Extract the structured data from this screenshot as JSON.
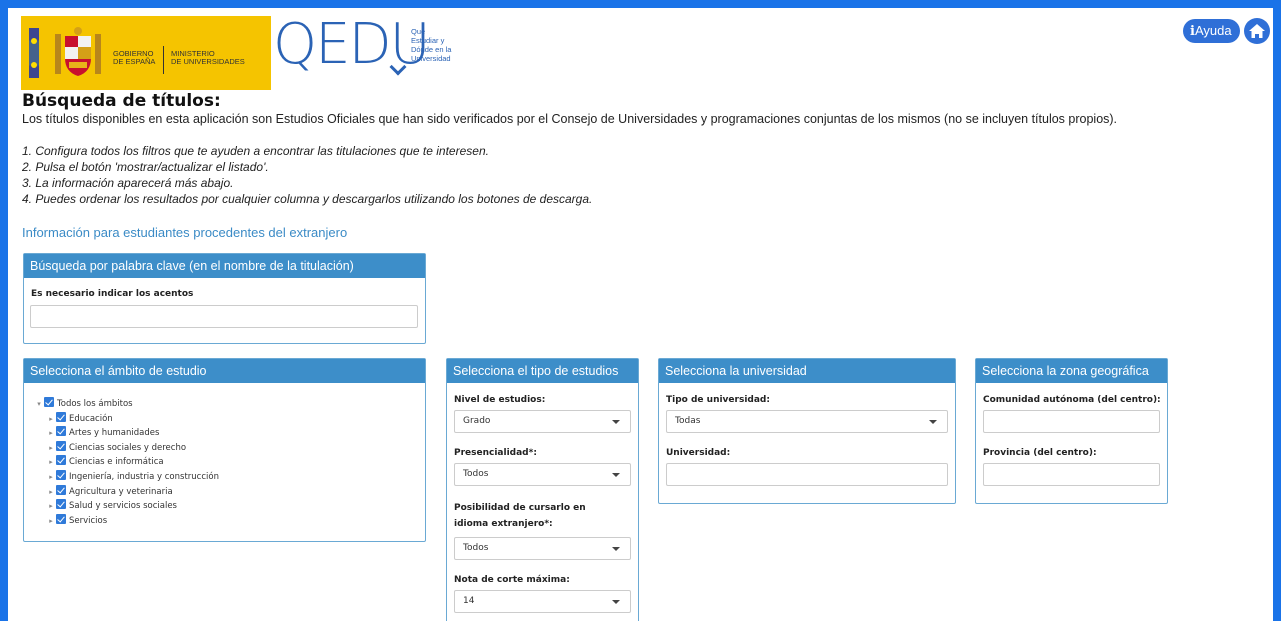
{
  "header": {
    "gov_line1": "GOBIERNO",
    "gov_line2": "DE ESPAÑA",
    "ministry_line1": "MINISTERIO",
    "ministry_line2": "DE UNIVERSIDADES",
    "logo_text": "QEDU",
    "logo_sub": [
      "Qué",
      "Estudiar y",
      "Dónde en la",
      "Universidad"
    ],
    "help_label": "Ayuda",
    "help_icon": "info-icon",
    "home_icon": "home-icon"
  },
  "intro": {
    "title": "Búsqueda de títulos:",
    "description": "Los títulos disponibles en esta aplicación son Estudios Oficiales que han sido verificados por el Consejo de Universidades y programaciones conjuntas de los mismos (no se incluyen títulos propios).",
    "steps": [
      "1. Configura todos los filtros que te ayuden a encontrar las titulaciones que te interesen.",
      "2. Pulsa el botón 'mostrar/actualizar el listado'.",
      "3. La información aparecerá más abajo.",
      "4. Puedes ordenar los resultados por cualquier columna y descargarlos utilizando los botones de descarga."
    ],
    "foreign_link": "Información para estudiantes procedentes del extranjero"
  },
  "keyword_panel": {
    "title": "Búsqueda por palabra clave (en el nombre de la titulación)",
    "label": "Es necesario indicar los acentos",
    "value": ""
  },
  "scope_panel": {
    "title": "Selecciona el ámbito de estudio",
    "root": "Todos los ámbitos",
    "items": [
      "Educación",
      "Artes y humanidades",
      "Ciencias sociales y derecho",
      "Ciencias e informática",
      "Ingeniería, industria y construcción",
      "Agricultura y veterinaria",
      "Salud y servicios sociales",
      "Servicios"
    ]
  },
  "study_type_panel": {
    "title": "Selecciona el tipo de estudios",
    "level_label": "Nivel de estudios:",
    "level_value": "Grado",
    "presence_label": "Presencialidad*:",
    "presence_value": "Todos",
    "language_label": "Posibilidad de cursarlo en idioma extranjero*:",
    "language_value": "Todos",
    "grade_label": "Nota de corte máxima:",
    "grade_value": "14"
  },
  "university_panel": {
    "title": "Selecciona la universidad",
    "type_label": "Tipo de universidad:",
    "type_value": "Todas",
    "university_label": "Universidad:",
    "university_value": ""
  },
  "geo_panel": {
    "title": "Selecciona la zona geográfica",
    "community_label": "Comunidad autónoma (del centro):",
    "community_value": "",
    "province_label": "Provincia (del centro):",
    "province_value": ""
  }
}
